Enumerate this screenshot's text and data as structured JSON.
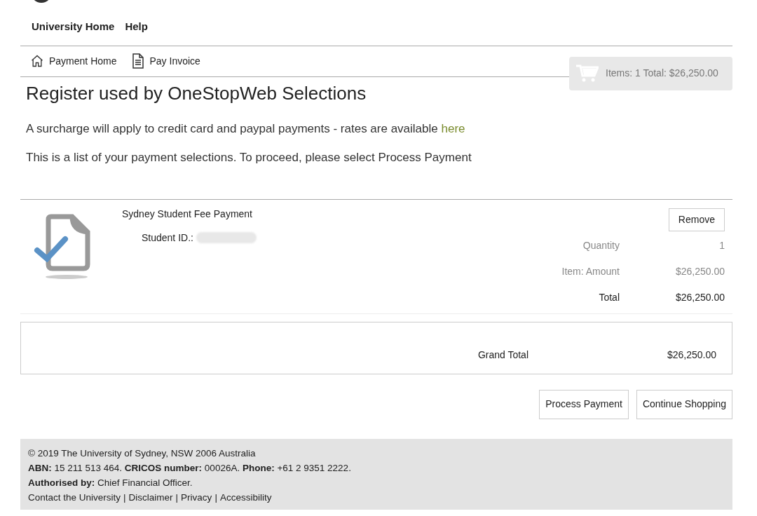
{
  "top_nav": [
    "University Home",
    "Help"
  ],
  "sub_nav": [
    {
      "label": "Payment Home",
      "kind": "home"
    },
    {
      "label": "Pay Invoice",
      "kind": "document"
    }
  ],
  "cart_summary": "Items: 1 Total: $26,250.00",
  "title": "Register used by OneStopWeb Selections",
  "notices": [
    {
      "text": "A surcharge will apply to credit card and paypal payments - rates are available ",
      "link": "here"
    },
    {
      "text": "This is a list of your payment selections. To proceed, please select Process Payment"
    }
  ],
  "item": {
    "name": "Sydney Student Fee Payment",
    "id_label": "Student ID.:",
    "remove_button": "Remove",
    "rows": [
      {
        "label": "Quantity",
        "value": "1",
        "emphasis": false
      },
      {
        "label": "Item: Amount",
        "value": "$26,250.00",
        "emphasis": false
      },
      {
        "label": "Total",
        "value": "$26,250.00",
        "emphasis": true
      }
    ]
  },
  "grand_total": {
    "label": "Grand Total",
    "value": "$26,250.00"
  },
  "buttons": [
    "Process Payment",
    "Continue Shopping"
  ],
  "footer": {
    "lines": [
      "© 2019 The University of Sydney, NSW 2006 Australia",
      "**ABN:** 15 211 513 464. **CRICOS number:** 00026A. **Phone:** +61 2 9351 2222.",
      "**Authorised by:** Chief Financial Officer."
    ],
    "links": [
      "Contact the University",
      "Disclaimer",
      "Privacy",
      "Accessibility"
    ],
    "separator": "|"
  }
}
